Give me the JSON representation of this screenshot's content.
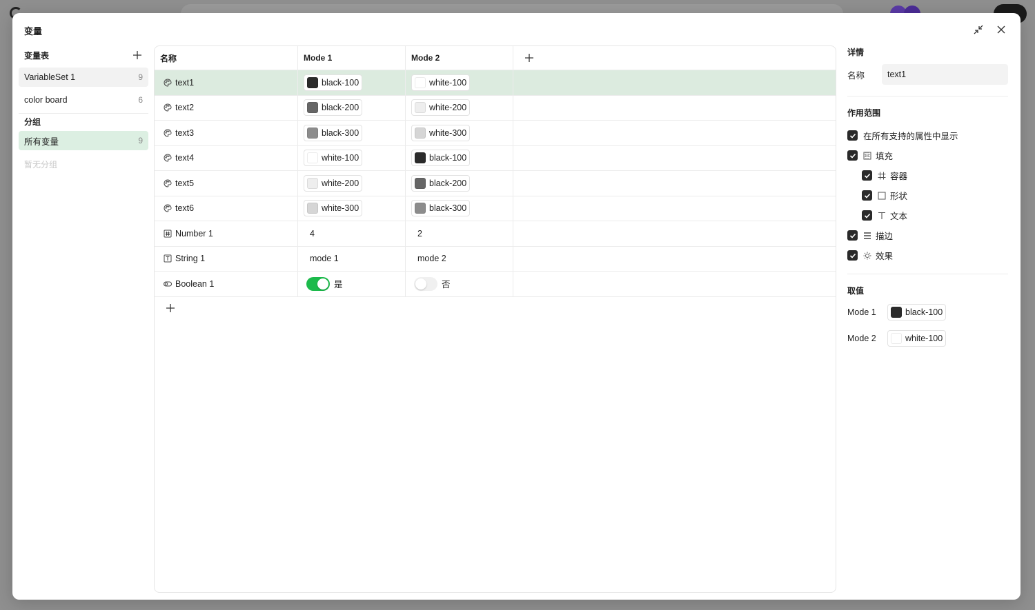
{
  "modal": {
    "title": "变量"
  },
  "sidebar": {
    "heading": "变量表",
    "sets": [
      {
        "label": "VariableSet 1",
        "count": "9"
      },
      {
        "label": "color board",
        "count": "6"
      }
    ],
    "group_heading": "分组",
    "groups": [
      {
        "label": "所有变量",
        "count": "9"
      }
    ],
    "empty_group_text": "暂无分组"
  },
  "table": {
    "headers": {
      "name": "名称",
      "mode1": "Mode 1",
      "mode2": "Mode 2"
    },
    "rows": [
      {
        "name": "text1",
        "icon": "palette-icon",
        "m1": {
          "label": "black-100",
          "color": "#2b2b2b"
        },
        "m2": {
          "label": "white-100",
          "color": "#ffffff"
        }
      },
      {
        "name": "text2",
        "icon": "palette-icon",
        "m1": {
          "label": "black-200",
          "color": "#666666"
        },
        "m2": {
          "label": "white-200",
          "color": "#eeeeee"
        }
      },
      {
        "name": "text3",
        "icon": "palette-icon",
        "m1": {
          "label": "black-300",
          "color": "#8c8c8c"
        },
        "m2": {
          "label": "white-300",
          "color": "#d6d6d6"
        }
      },
      {
        "name": "text4",
        "icon": "palette-icon",
        "m1": {
          "label": "white-100",
          "color": "#ffffff"
        },
        "m2": {
          "label": "black-100",
          "color": "#2b2b2b"
        }
      },
      {
        "name": "text5",
        "icon": "palette-icon",
        "m1": {
          "label": "white-200",
          "color": "#eeeeee"
        },
        "m2": {
          "label": "black-200",
          "color": "#666666"
        }
      },
      {
        "name": "text6",
        "icon": "palette-icon",
        "m1": {
          "label": "white-300",
          "color": "#d6d6d6"
        },
        "m2": {
          "label": "black-300",
          "color": "#8c8c8c"
        }
      },
      {
        "name": "Number 1",
        "icon": "number-icon",
        "m1": {
          "value": "4"
        },
        "m2": {
          "value": "2"
        }
      },
      {
        "name": "String 1",
        "icon": "string-icon",
        "m1": {
          "value": "mode 1"
        },
        "m2": {
          "value": "mode 2"
        }
      },
      {
        "name": "Boolean 1",
        "icon": "boolean-icon",
        "m1": {
          "toggle_label": "是",
          "on": true
        },
        "m2": {
          "toggle_label": "否",
          "on": false
        }
      }
    ]
  },
  "details": {
    "title": "详情",
    "name_label": "名称",
    "name_value": "text1",
    "scope_title": "作用范围",
    "scope": {
      "all": "在所有支持的属性中显示",
      "fill": "填充",
      "container": "容器",
      "shape": "形状",
      "text": "文本",
      "stroke": "描边",
      "effect": "效果"
    },
    "values_title": "取值",
    "values": [
      {
        "mode": "Mode 1",
        "label": "black-100",
        "color": "#2b2b2b"
      },
      {
        "mode": "Mode 2",
        "label": "white-100",
        "color": "#ffffff"
      }
    ]
  },
  "colors": {
    "selected_row": "#dcebdf",
    "toggle_on": "#1cba4b",
    "checkbox": "#2a2a2a"
  }
}
